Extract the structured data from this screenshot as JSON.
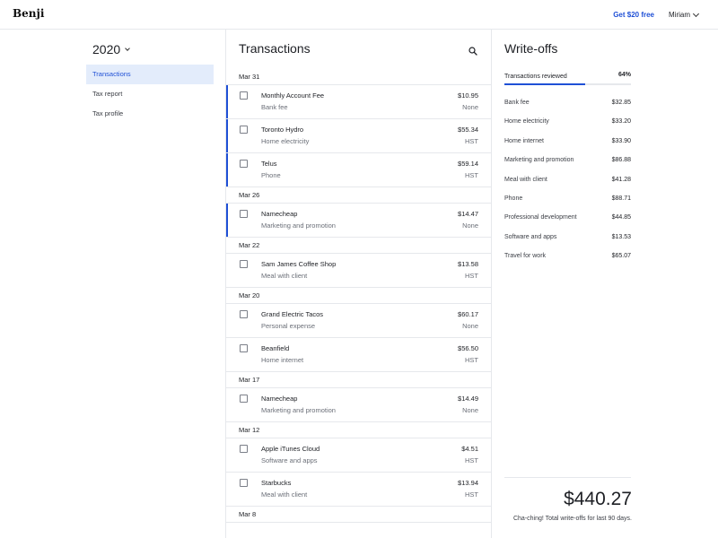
{
  "header": {
    "logo": "Benji",
    "promo_label": "Get $20 free",
    "user_name": "Miriam"
  },
  "sidebar": {
    "year": "2020",
    "items": [
      {
        "label": "Transactions",
        "active": true
      },
      {
        "label": "Tax report",
        "active": false
      },
      {
        "label": "Tax profile",
        "active": false
      }
    ]
  },
  "transactions": {
    "title": "Transactions",
    "groups": [
      {
        "date": "Mar 31",
        "items": [
          {
            "name": "Monthly Account Fee",
            "category": "Bank fee",
            "amount": "$10.95",
            "tax": "None",
            "flagged": true
          },
          {
            "name": "Toronto Hydro",
            "category": "Home electricity",
            "amount": "$55.34",
            "tax": "HST",
            "flagged": true
          },
          {
            "name": "Telus",
            "category": "Phone",
            "amount": "$59.14",
            "tax": "HST",
            "flagged": true
          }
        ]
      },
      {
        "date": "Mar 26",
        "items": [
          {
            "name": "Namecheap",
            "category": "Marketing and promotion",
            "amount": "$14.47",
            "tax": "None",
            "flagged": true
          }
        ]
      },
      {
        "date": "Mar 22",
        "items": [
          {
            "name": "Sam James Coffee Shop",
            "category": "Meal with client",
            "amount": "$13.58",
            "tax": "HST",
            "flagged": false
          }
        ]
      },
      {
        "date": "Mar 20",
        "items": [
          {
            "name": "Grand Electric Tacos",
            "category": "Personal expense",
            "amount": "$60.17",
            "tax": "None",
            "flagged": false
          },
          {
            "name": "Beanfield",
            "category": "Home internet",
            "amount": "$56.50",
            "tax": "HST",
            "flagged": false
          }
        ]
      },
      {
        "date": "Mar 17",
        "items": [
          {
            "name": "Namecheap",
            "category": "Marketing and promotion",
            "amount": "$14.49",
            "tax": "None",
            "flagged": false
          }
        ]
      },
      {
        "date": "Mar 12",
        "items": [
          {
            "name": "Apple iTunes Cloud",
            "category": "Software and apps",
            "amount": "$4.51",
            "tax": "HST",
            "flagged": false
          },
          {
            "name": "Starbucks",
            "category": "Meal with client",
            "amount": "$13.94",
            "tax": "HST",
            "flagged": false
          }
        ]
      },
      {
        "date": "Mar 8",
        "items": []
      }
    ]
  },
  "writeoffs": {
    "title": "Write-offs",
    "progress_label": "Transactions reviewed",
    "progress_pct_text": "64%",
    "progress_fraction": 0.64,
    "items": [
      {
        "label": "Bank fee",
        "amount": "$32.85"
      },
      {
        "label": "Home electricity",
        "amount": "$33.20"
      },
      {
        "label": "Home internet",
        "amount": "$33.90"
      },
      {
        "label": "Marketing and promotion",
        "amount": "$86.88"
      },
      {
        "label": "Meal with client",
        "amount": "$41.28"
      },
      {
        "label": "Phone",
        "amount": "$88.71"
      },
      {
        "label": "Professional development",
        "amount": "$44.85"
      },
      {
        "label": "Software and apps",
        "amount": "$13.53"
      },
      {
        "label": "Travel for work",
        "amount": "$65.07"
      }
    ],
    "total": "$440.27",
    "total_caption": "Cha-ching! Total write-offs for last 90 days."
  },
  "colors": {
    "accent": "#1f50d6",
    "active_bg": "#e3ecfb",
    "divider": "#e6e8ec"
  }
}
